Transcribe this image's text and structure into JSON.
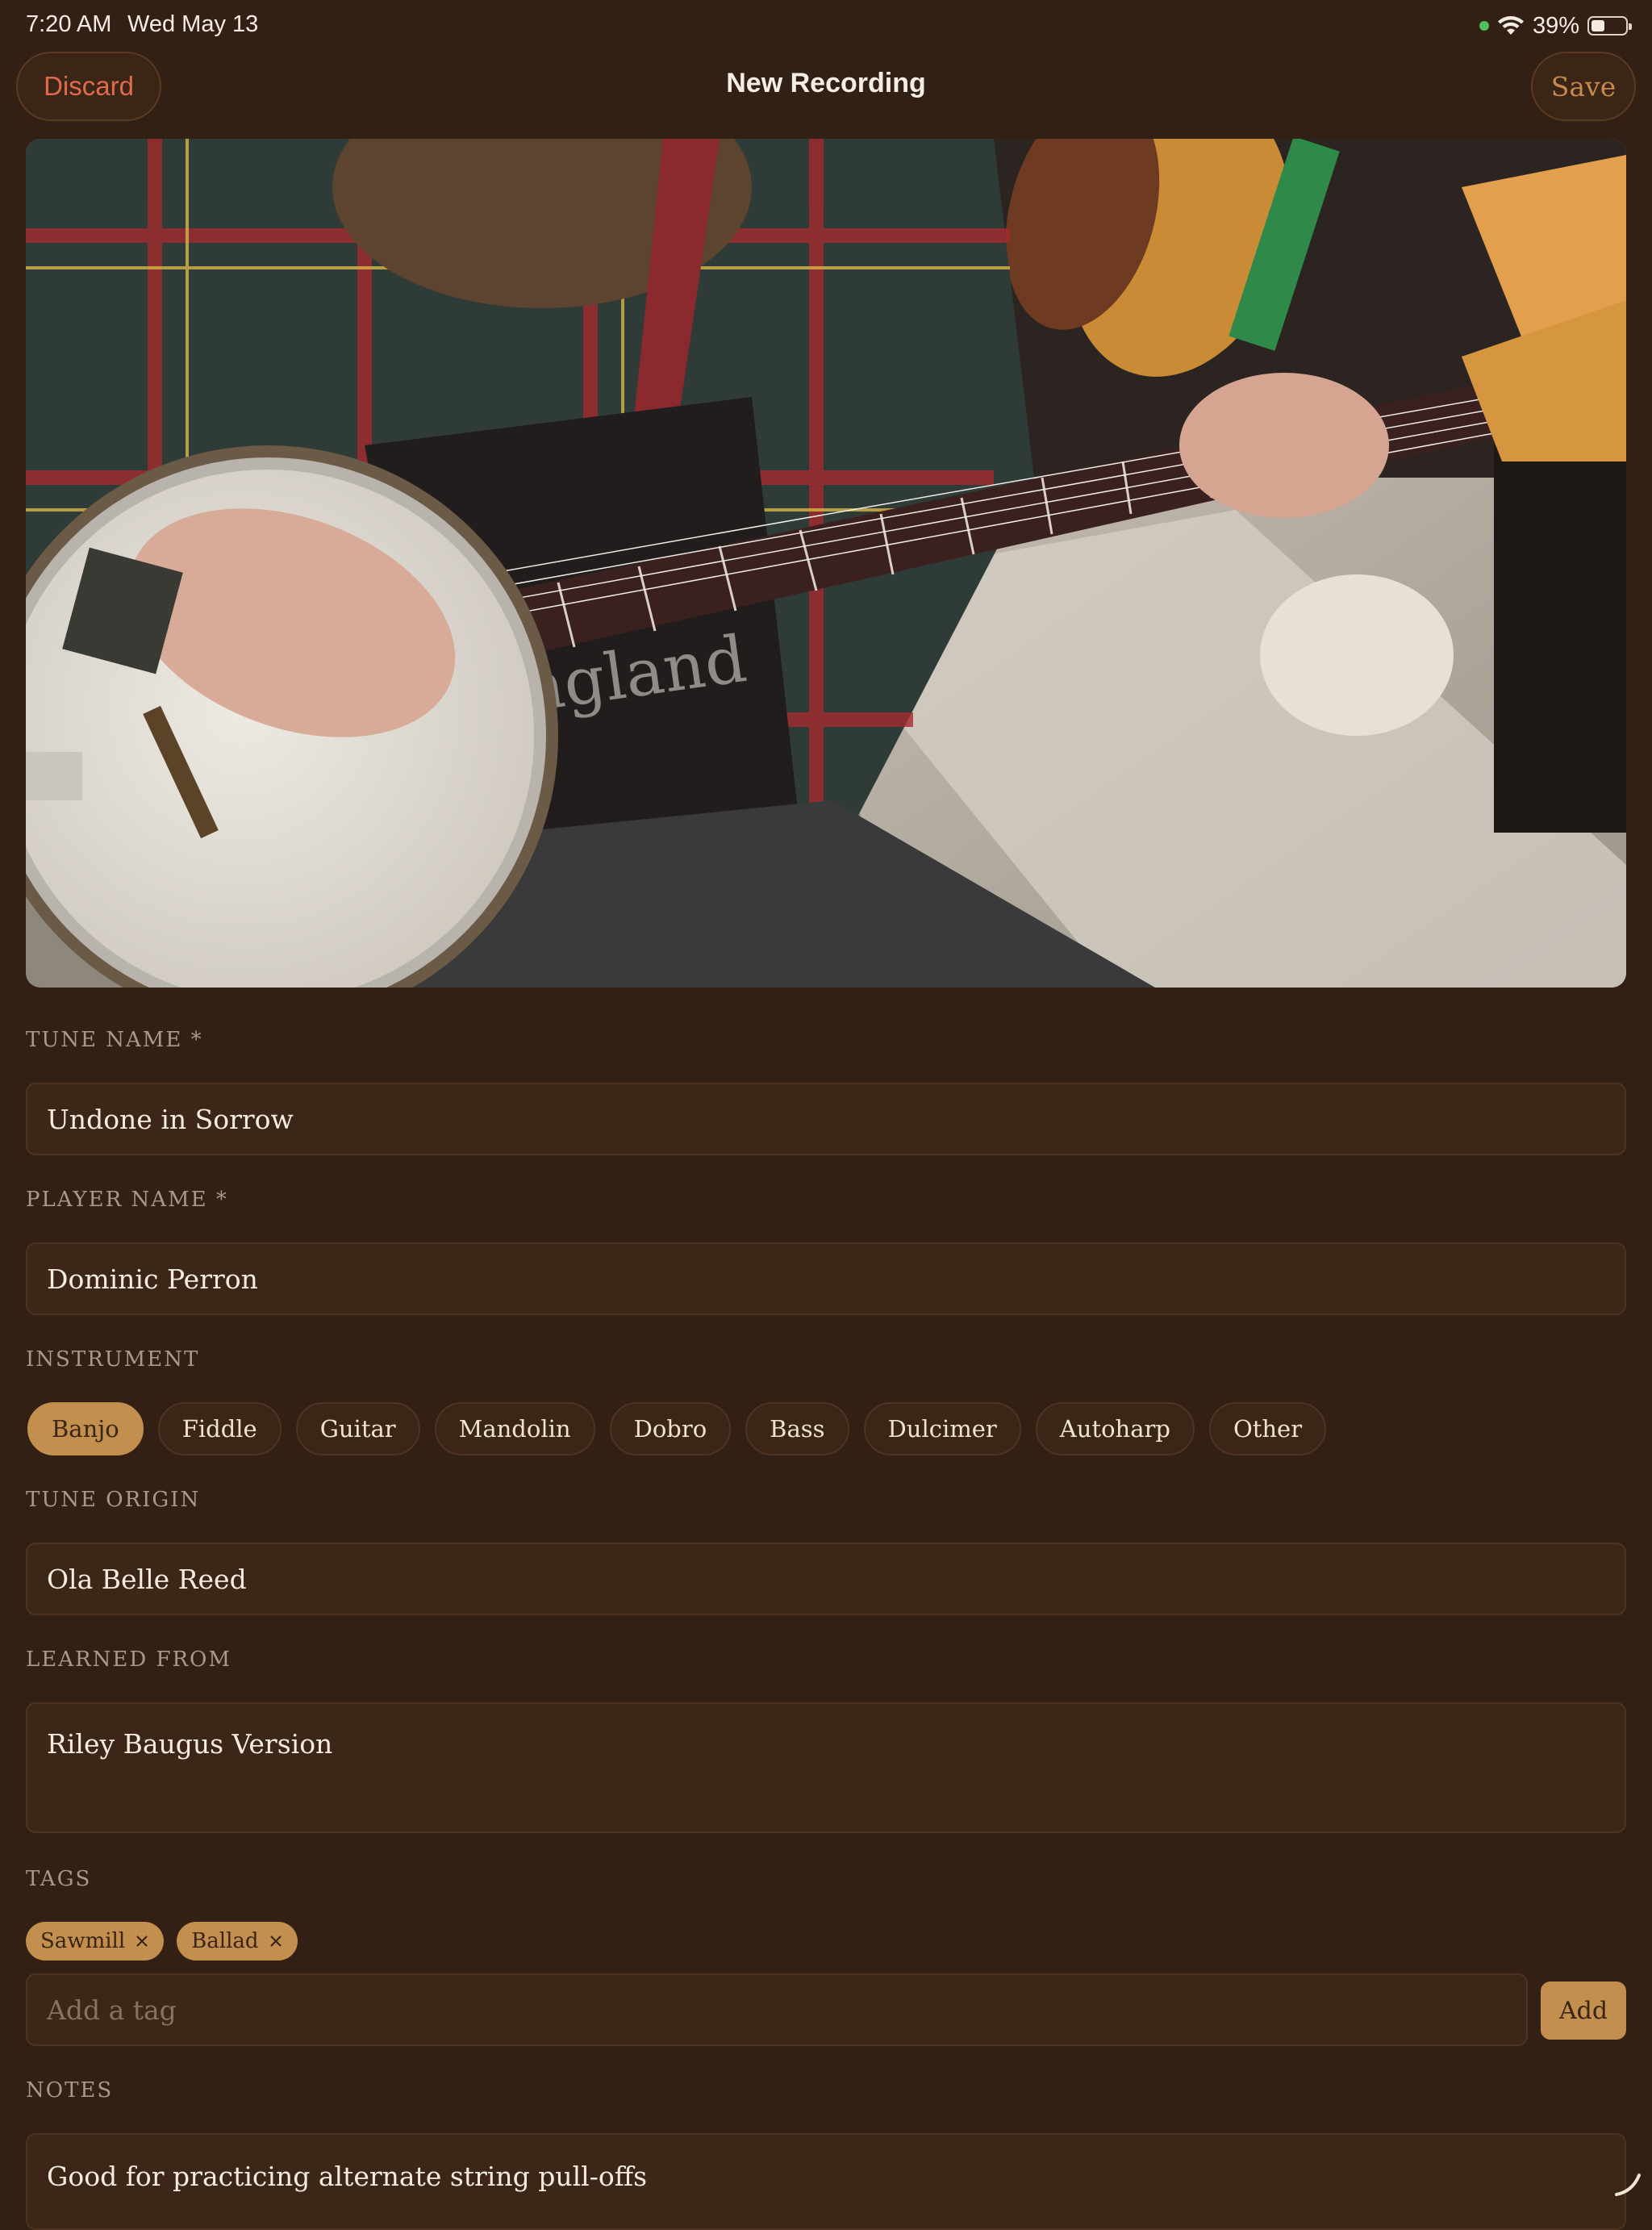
{
  "status_bar": {
    "time": "7:20 AM",
    "date": "Wed May 13",
    "battery_pct": "39%",
    "battery_level": 0.39
  },
  "nav": {
    "discard_label": "Discard",
    "title": "New Recording",
    "save_label": "Save"
  },
  "form": {
    "tune_name": {
      "label": "TUNE NAME *",
      "value": "Undone in Sorrow"
    },
    "player_name": {
      "label": "PLAYER NAME *",
      "value": "Dominic Perron"
    },
    "instrument": {
      "label": "INSTRUMENT",
      "options": [
        "Banjo",
        "Fiddle",
        "Guitar",
        "Mandolin",
        "Dobro",
        "Bass",
        "Dulcimer",
        "Autoharp",
        "Other"
      ],
      "selected": "Banjo"
    },
    "tune_origin": {
      "label": "TUNE ORIGIN",
      "value": "Ola Belle Reed"
    },
    "learned_from": {
      "label": "LEARNED FROM",
      "value": "Riley Baugus Version"
    },
    "tags": {
      "label": "TAGS",
      "items": [
        "Sawmill",
        "Ballad"
      ],
      "input_placeholder": "Add a tag",
      "add_label": "Add"
    },
    "notes": {
      "label": "NOTES",
      "value": "Good for practicing alternate string pull-offs"
    }
  },
  "colors": {
    "background": "#332015",
    "accent": "#c38f4e",
    "destructive": "#e06a4e",
    "field": "#3b2618"
  }
}
